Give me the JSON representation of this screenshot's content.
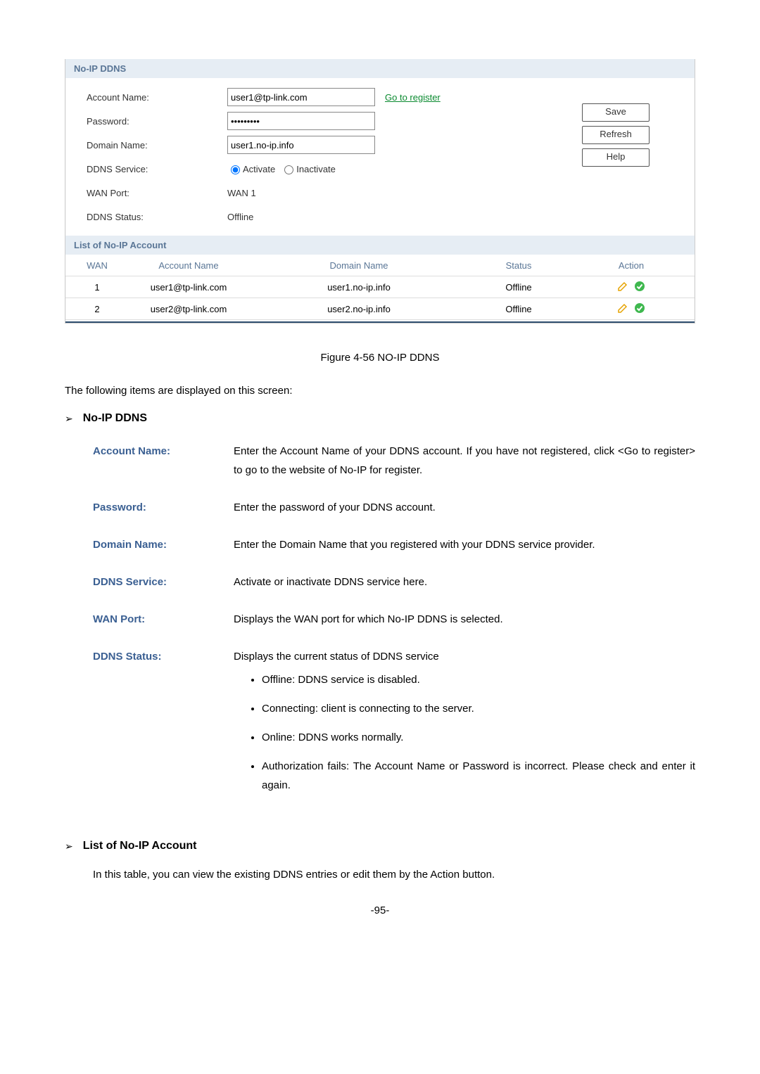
{
  "shot": {
    "section1_title": "No-IP DDNS",
    "labels": {
      "account_name": "Account Name:",
      "password": "Password:",
      "domain_name": "Domain Name:",
      "ddns_service": "DDNS Service:",
      "wan_port": "WAN Port:",
      "ddns_status": "DDNS Status:"
    },
    "values": {
      "account_name": "user1@tp-link.com",
      "password": "•••••••••",
      "domain_name": "user1.no-ip.info",
      "wan_port": "WAN 1",
      "ddns_status": "Offline"
    },
    "register_link": "Go to register",
    "radio_activate": "Activate",
    "radio_inactivate": "Inactivate",
    "buttons": {
      "save": "Save",
      "refresh": "Refresh",
      "help": "Help"
    },
    "section2_title": "List of No-IP Account",
    "table_headers": {
      "wan": "WAN",
      "account": "Account Name",
      "domain": "Domain Name",
      "status": "Status",
      "action": "Action"
    },
    "rows": [
      {
        "wan": "1",
        "account": "user1@tp-link.com",
        "domain": "user1.no-ip.info",
        "status": "Offline"
      },
      {
        "wan": "2",
        "account": "user2@tp-link.com",
        "domain": "user2.no-ip.info",
        "status": "Offline"
      }
    ]
  },
  "doc": {
    "figure_caption": "Figure 4-56 NO-IP DDNS",
    "intro": "The following items are displayed on this screen:",
    "heading1": "No-IP DDNS",
    "fields": {
      "account_name": {
        "label": "Account Name:",
        "desc": "Enter the Account Name of your DDNS account. If you have not registered, click <Go to register> to go to the website of No-IP for register."
      },
      "password": {
        "label": "Password:",
        "desc": "Enter the password of your DDNS account."
      },
      "domain_name": {
        "label": "Domain Name:",
        "desc": "Enter the Domain Name that you registered with your DDNS service provider."
      },
      "ddns_service": {
        "label": "DDNS Service:",
        "desc": "Activate or inactivate DDNS service here."
      },
      "wan_port": {
        "label": "WAN Port:",
        "desc": "Displays the WAN port for which No-IP DDNS is selected."
      },
      "ddns_status": {
        "label": "DDNS Status:",
        "desc": "Displays the current status of DDNS service",
        "bullets": [
          "Offline: DDNS service is disabled.",
          "Connecting: client is connecting to the server.",
          "Online: DDNS works normally.",
          "Authorization fails: The Account Name or Password is incorrect. Please check and enter it again."
        ]
      }
    },
    "heading2": "List of No-IP Account",
    "list_para": "In this table, you can view the existing DDNS entries or edit them by the Action button.",
    "page_num": "-95-"
  }
}
